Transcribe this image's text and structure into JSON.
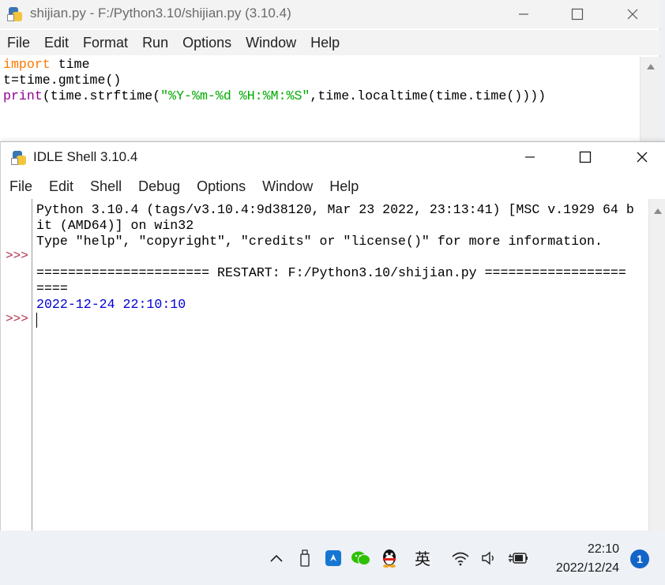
{
  "editor": {
    "title": "shijian.py - F:/Python3.10/shijian.py (3.10.4)",
    "menu": [
      "File",
      "Edit",
      "Format",
      "Run",
      "Options",
      "Window",
      "Help"
    ],
    "code": {
      "line1_kw": "import",
      "line1_rest": " time",
      "line2": "t=time.gmtime()",
      "line3_bi": "print",
      "line3_a": "(time.strftime(",
      "line3_str": "\"%Y-%m-%d %H:%M:%S\"",
      "line3_b": ",time.localtime(time.time())))"
    }
  },
  "shell": {
    "title": "IDLE Shell 3.10.4",
    "menu": [
      "File",
      "Edit",
      "Shell",
      "Debug",
      "Options",
      "Window",
      "Help"
    ],
    "prompt": ">>>",
    "lines": {
      "banner1": "Python 3.10.4 (tags/v3.10.4:9d38120, Mar 23 2022, 23:13:41) [MSC v.1929 64 b",
      "banner2": "it (AMD64)] on win32",
      "banner3": "Type \"help\", \"copyright\", \"credits\" or \"license()\" for more information.",
      "restart1": "====================== RESTART: F:/Python3.10/shijian.py ==================",
      "restart2": "====",
      "output": "2022-12-24 22:10:10"
    }
  },
  "taskbar": {
    "ime": "英",
    "time": "22:10",
    "date": "2022/12/24",
    "notifications": "1",
    "icons": [
      "chevron-up-icon",
      "usb-drive-icon",
      "blue-app-icon",
      "wechat-icon",
      "qq-penguin-icon",
      "wifi-icon",
      "speaker-icon",
      "battery-plug-icon"
    ]
  }
}
